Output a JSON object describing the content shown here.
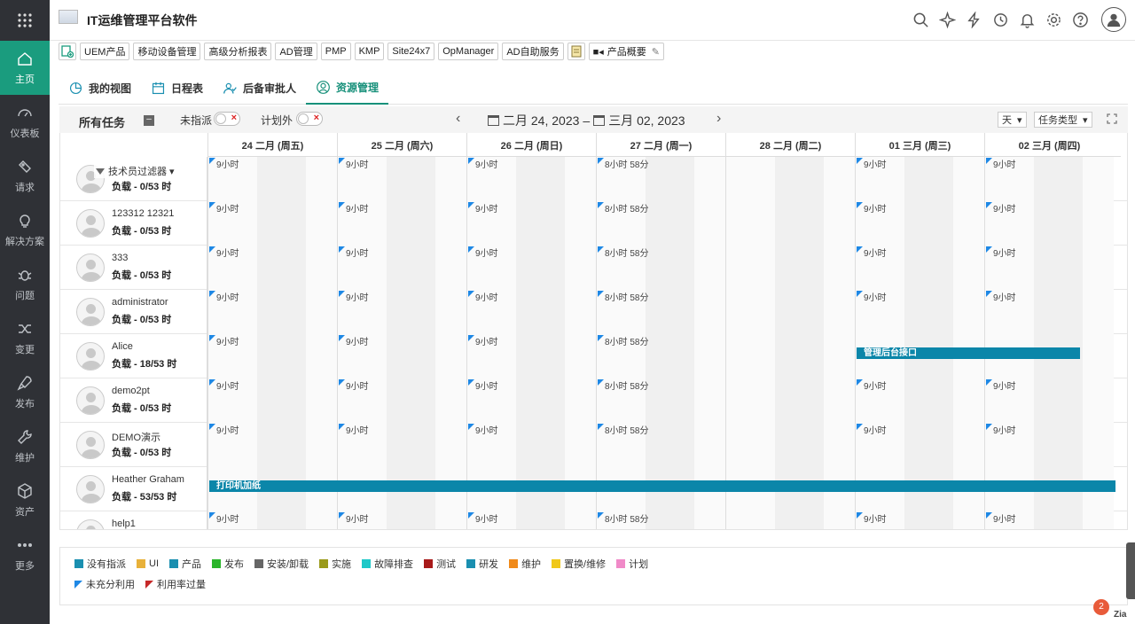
{
  "app": {
    "title": "IT运维管理平台软件"
  },
  "sidebar": {
    "items": [
      {
        "label": "主页",
        "icon": "home-icon",
        "active": true
      },
      {
        "label": "仪表板",
        "icon": "dashboard-icon"
      },
      {
        "label": "请求",
        "icon": "ticket-icon"
      },
      {
        "label": "解决方案",
        "icon": "lightbulb-icon"
      },
      {
        "label": "问题",
        "icon": "bug-icon"
      },
      {
        "label": "变更",
        "icon": "shuffle-icon"
      },
      {
        "label": "发布",
        "icon": "rocket-icon"
      },
      {
        "label": "维护",
        "icon": "wrench-icon"
      },
      {
        "label": "资产",
        "icon": "cube-icon"
      },
      {
        "label": "更多",
        "icon": "more-icon"
      }
    ]
  },
  "products": [
    "UEM产品",
    "移动设备管理",
    "高级分析报表",
    "AD管理",
    "PMP",
    "KMP",
    "Site24x7",
    "OpManager",
    "AD自助服务",
    "产品概要"
  ],
  "tabs": [
    {
      "label": "我的视图",
      "icon": "pie-chart-icon"
    },
    {
      "label": "日程表",
      "icon": "calendar-icon"
    },
    {
      "label": "后备审批人",
      "icon": "user-check-icon"
    },
    {
      "label": "资源管理",
      "icon": "user-circle-icon",
      "active": true
    }
  ],
  "toolbar": {
    "all_tasks": "所有任务",
    "unassigned_label": "未指派",
    "unplanned_label": "计划外",
    "start_date": "二月 24, 2023",
    "separator": "–",
    "end_date": "三月 02, 2023",
    "view_select": "天",
    "type_select": "任务类型"
  },
  "filter_label": "技术员过滤器",
  "days": [
    "24 二月 (周五)",
    "25 二月 (周六)",
    "26 二月 (周日)",
    "27 二月 (周一)",
    "28 二月 (周二)",
    "01 三月 (周三)",
    "02 三月 (周四)"
  ],
  "rows": [
    {
      "name": "",
      "load": "负载 - 0/53 时",
      "hours": [
        "9小时",
        "9小时",
        "9小时",
        "8小时 58分",
        "",
        "9小时",
        "9小时"
      ]
    },
    {
      "name": "123312 12321",
      "load": "负载 - 0/53 时",
      "hours": [
        "9小时",
        "9小时",
        "9小时",
        "8小时 58分",
        "",
        "9小时",
        "9小时"
      ]
    },
    {
      "name": "333",
      "load": "负载 - 0/53 时",
      "hours": [
        "9小时",
        "9小时",
        "9小时",
        "8小时 58分",
        "",
        "9小时",
        "9小时"
      ]
    },
    {
      "name": "administrator",
      "load": "负载 - 0/53 时",
      "hours": [
        "9小时",
        "9小时",
        "9小时",
        "8小时 58分",
        "",
        "9小时",
        "9小时"
      ]
    },
    {
      "name": "Alice",
      "load": "负载 - 18/53 时",
      "hours": [
        "9小时",
        "9小时",
        "9小时",
        "8小时 58分",
        "",
        "",
        ""
      ],
      "task": "管理后台接口"
    },
    {
      "name": "demo2pt",
      "load": "负载 - 0/53 时",
      "hours": [
        "9小时",
        "9小时",
        "9小时",
        "8小时 58分",
        "",
        "9小时",
        "9小时"
      ]
    },
    {
      "name": "DEMO演示",
      "load": "负载 - 0/53 时",
      "hours": [
        "9小时",
        "9小时",
        "9小时",
        "8小时 58分",
        "",
        "9小时",
        "9小时"
      ]
    },
    {
      "name": "Heather Graham",
      "load": "负载 - 53/53 时",
      "hours": [
        "",
        "",
        "",
        "",
        "",
        "",
        ""
      ],
      "task": "打印机加纸"
    },
    {
      "name": "help1",
      "load": "",
      "hours": [
        "9小时",
        "9小时",
        "9小时",
        "8小时 58分",
        "",
        "9小时",
        "9小时"
      ]
    }
  ],
  "legend": [
    {
      "label": "没有指派",
      "color": "#1a8fb0"
    },
    {
      "label": "UI",
      "color": "#e8b13a"
    },
    {
      "label": "产品",
      "color": "#1a8fb0"
    },
    {
      "label": "发布",
      "color": "#2bb52b"
    },
    {
      "label": "安装/卸载",
      "color": "#666666"
    },
    {
      "label": "实施",
      "color": "#9a9a1a"
    },
    {
      "label": "故障排查",
      "color": "#1ec8c8"
    },
    {
      "label": "测试",
      "color": "#a81a1a"
    },
    {
      "label": "研发",
      "color": "#1a8fb0"
    },
    {
      "label": "维护",
      "color": "#f08a1a"
    },
    {
      "label": "置换/维修",
      "color": "#f0c81a"
    },
    {
      "label": "计划",
      "color": "#f08ac8"
    }
  ],
  "legend_markers": [
    {
      "label": "未充分利用",
      "color": "#1e88e5"
    },
    {
      "label": "利用率过量",
      "color": "#c62828"
    }
  ],
  "notification_count": "2",
  "zia_label": "Zia"
}
